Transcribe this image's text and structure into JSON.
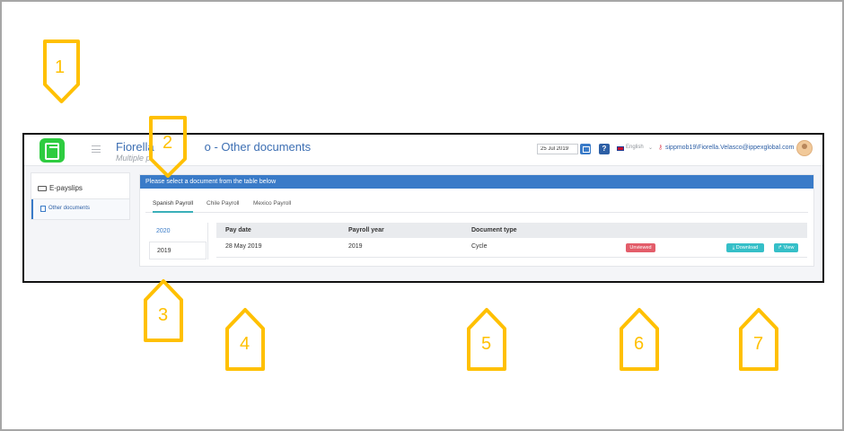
{
  "app": {
    "title": "Fiorella Velasco - Other documents",
    "title_visible": "Fiorella",
    "title_visible_end": "o - Other documents",
    "subtitle": "Multiple p",
    "date": "25 Jul 2019",
    "help": "?",
    "language": "English",
    "language_chevron": "⌄",
    "key_glyph": "⚷",
    "user": "sippmob19\\Fiorella.Velasco@ippexglobal.com"
  },
  "sidebar": {
    "section": "E-payslips",
    "item": "Other documents"
  },
  "main": {
    "banner": "Please select a document from the table below",
    "tabs": [
      "Spanish Payroll",
      "Chile Payroll",
      "Mexico Payroll"
    ],
    "years": [
      "2020",
      "2019"
    ],
    "table": {
      "headers": [
        "Pay date",
        "Payroll year",
        "Document type"
      ],
      "rows": [
        {
          "pay_date": "28 May 2019",
          "payroll_year": "2019",
          "document_type": "Cycle",
          "status": "Unviewed",
          "download": "Download",
          "view": "View"
        }
      ]
    }
  },
  "callouts": [
    "1",
    "2",
    "3",
    "4",
    "5",
    "6",
    "7"
  ],
  "colors": {
    "accent": "#3a7bc8",
    "callout": "#ffc000",
    "badge": "#e35d6a",
    "action": "#35bfc8"
  }
}
